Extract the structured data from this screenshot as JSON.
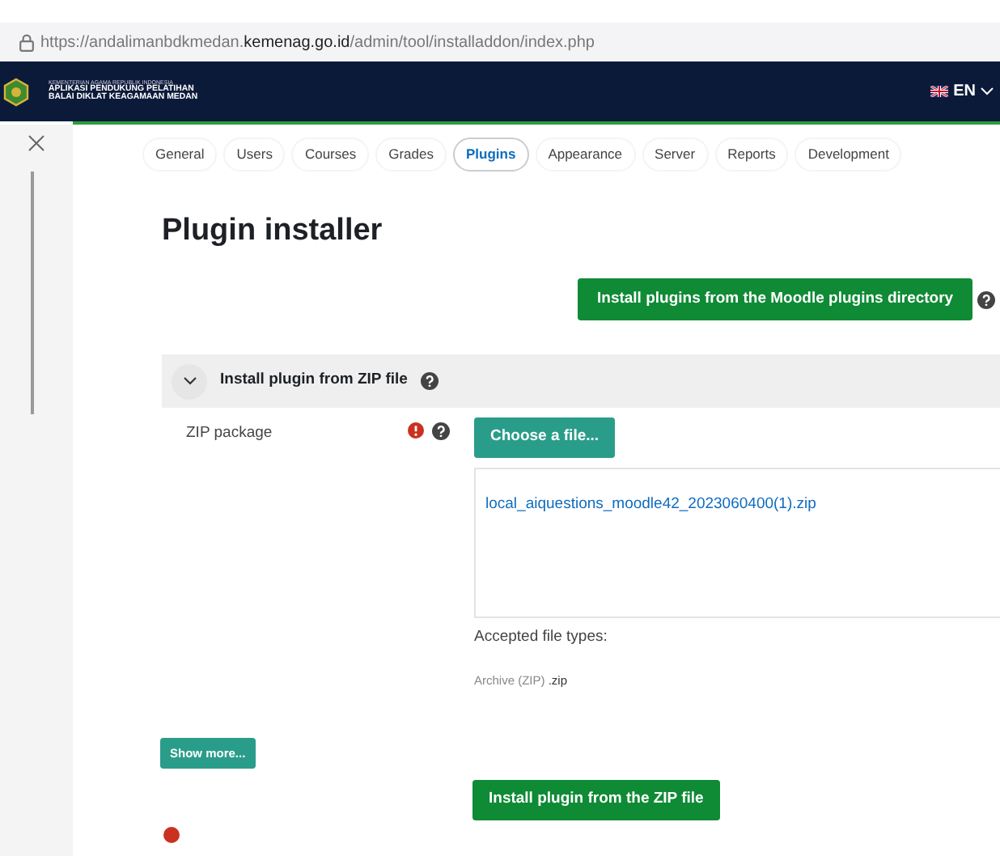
{
  "address_bar": {
    "url_prefix": "https://andalimanbdkmedan.",
    "url_domain": "kemenag.go.id",
    "url_path": "/admin/tool/installaddon/index.php"
  },
  "header": {
    "ministry": "KEMENTERIAN AGAMA REPUBLIK INDONESIA",
    "app_name_line1": "APLIKASI PENDUKUNG PELATIHAN",
    "app_name_line2": "BALAI DIKLAT KEAGAMAAN MEDAN",
    "language": "EN"
  },
  "tabs": [
    {
      "label": "General",
      "selected": false
    },
    {
      "label": "Users",
      "selected": false
    },
    {
      "label": "Courses",
      "selected": false
    },
    {
      "label": "Grades",
      "selected": false
    },
    {
      "label": "Plugins",
      "selected": true
    },
    {
      "label": "Appearance",
      "selected": false
    },
    {
      "label": "Server",
      "selected": false
    },
    {
      "label": "Reports",
      "selected": false
    },
    {
      "label": "Development",
      "selected": false
    }
  ],
  "title": "Plugin installer",
  "directory_button": "Install plugins from the Moodle plugins directory",
  "section": {
    "title": "Install plugin from ZIP file",
    "expanded": true
  },
  "zip_field": {
    "label": "ZIP package",
    "required": true,
    "button": "Choose a file...",
    "file": "local_aiquestions_moodle42_2023060400(1).zip",
    "accepted_label": "Accepted file types:",
    "accepted_type": "Archive (ZIP)",
    "accepted_ext": ".zip"
  },
  "show_more_button": "Show more...",
  "install_button": "Install plugin from the ZIP file"
}
